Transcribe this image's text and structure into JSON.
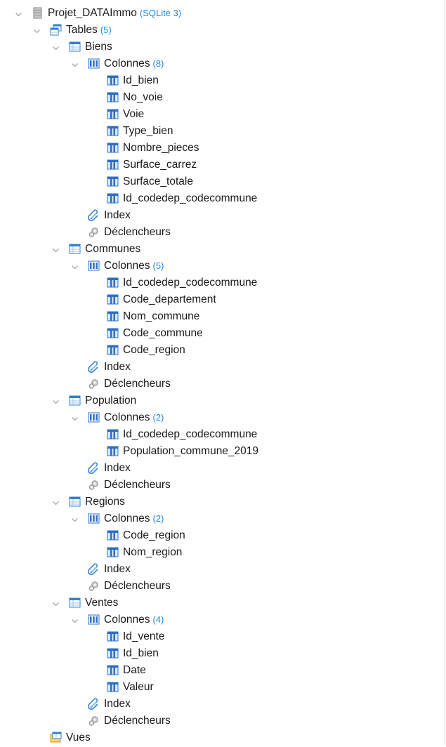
{
  "db": {
    "name": "Projet_DATAImmo",
    "engine": "(SQLite 3)"
  },
  "tables_node": {
    "label": "Tables",
    "count": "(5)"
  },
  "labels": {
    "columns": "Colonnes",
    "index": "Index",
    "triggers": "Déclencheurs"
  },
  "tables": [
    {
      "name": "Biens",
      "col_count": "(8)",
      "columns": [
        "Id_bien",
        "No_voie",
        "Voie",
        "Type_bien",
        "Nombre_pieces",
        "Surface_carrez",
        "Surface_totale",
        "Id_codedep_codecommune"
      ]
    },
    {
      "name": "Communes",
      "col_count": "(5)",
      "columns": [
        "Id_codedep_codecommune",
        "Code_departement",
        "Nom_commune",
        "Code_commune",
        "Code_region"
      ]
    },
    {
      "name": "Population",
      "col_count": "(2)",
      "columns": [
        "Id_codedep_codecommune",
        "Population_commune_2019"
      ]
    },
    {
      "name": "Regions",
      "col_count": "(2)",
      "columns": [
        "Code_region",
        "Nom_region"
      ]
    },
    {
      "name": "Ventes",
      "col_count": "(4)",
      "columns": [
        "Id_vente",
        "Id_bien",
        "Date",
        "Valeur"
      ]
    }
  ],
  "views_node": {
    "label": "Vues"
  },
  "colors": {
    "count": "#1e88e5",
    "chevron": "#a6a6a6",
    "table_icon": "#2f7fd1",
    "column_icon": "#2b6fc4"
  },
  "icons": {
    "database": "database-icon",
    "tables": "tables-icon",
    "table": "table-icon",
    "columns": "columns-icon",
    "column": "column-icon",
    "index": "index-icon",
    "trigger": "trigger-icon",
    "views": "views-icon"
  }
}
